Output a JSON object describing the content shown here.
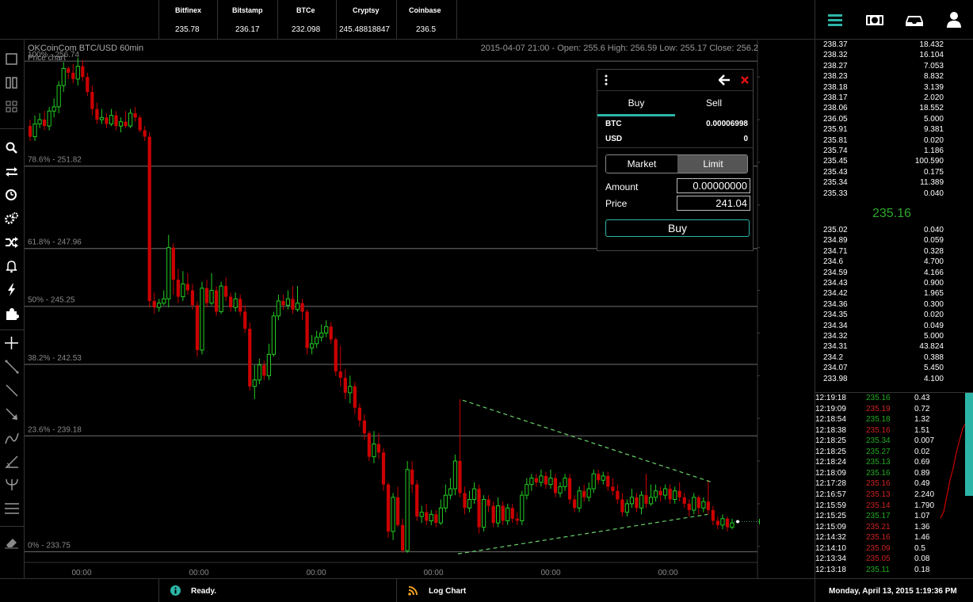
{
  "tickers": [
    {
      "name": "Bitfinex",
      "value": "235.78"
    },
    {
      "name": "Bitstamp",
      "value": "236.17"
    },
    {
      "name": "BTCe",
      "value": "232.098"
    },
    {
      "name": "Cryptsy",
      "value": "245.48818847"
    },
    {
      "name": "Coinbase",
      "value": "236.5"
    }
  ],
  "colors": {
    "up": "#22cc22",
    "down": "#cc0000",
    "accent": "#2cb5a7",
    "fib": "#555555",
    "trend": "#6bd36b"
  },
  "toolbar_icons": [
    "menu-icon",
    "money-icon",
    "inbox-icon",
    "user-icon"
  ],
  "left_tools": [
    "single-layout-icon",
    "split-layout-icon",
    "grid-layout-icon",
    "search-icon",
    "swap-icon",
    "clock-icon",
    "settings-icon",
    "shuffle-icon",
    "bell-icon",
    "lightning-icon",
    "puzzle-icon",
    "crosshair-icon",
    "line-tool-icon",
    "segment-tool-icon",
    "arrow-tool-icon",
    "curve-tool-icon",
    "angle-tool-icon",
    "pitchfork-tool-icon",
    "parallel-lines-icon",
    "eraser-icon"
  ],
  "chart": {
    "title": "OKCoinCom BTC/USD 60min",
    "subtitle": "Price chart",
    "ohlc": "2015-04-07 21:00 - Open: 255.6 High: 256.59 Low: 255.17 Close: 256.2"
  },
  "chart_data": {
    "type": "candlestick",
    "title": "OKCoinCom BTC/USD 60min",
    "ylim": [
      233.25,
      257.75
    ],
    "y_ticks": [
      234,
      236,
      238,
      240,
      242,
      244,
      246,
      248,
      250,
      252,
      254,
      256
    ],
    "x_ticks": [
      "00:00",
      "00:00",
      "00:00",
      "00:00",
      "00:00",
      "00:00"
    ],
    "fib_levels": [
      {
        "label": "100% - 256.74",
        "value": 256.74
      },
      {
        "label": "78.6% - 251.82",
        "value": 251.82
      },
      {
        "label": "61.8% - 247.96",
        "value": 247.96
      },
      {
        "label": "50% - 245.25",
        "value": 245.25
      },
      {
        "label": "38.2% - 242.53",
        "value": 242.53
      },
      {
        "label": "23.6% - 239.18",
        "value": 239.18
      },
      {
        "label": "0% - 233.75",
        "value": 233.75
      }
    ],
    "candles": [
      [
        253.7,
        253.2,
        254.0,
        253.0
      ],
      [
        253.2,
        253.8,
        254.2,
        253.0
      ],
      [
        253.8,
        254.0,
        254.3,
        253.6
      ],
      [
        254.0,
        253.7,
        254.4,
        253.5
      ],
      [
        253.7,
        254.4,
        254.6,
        253.5
      ],
      [
        254.4,
        254.6,
        255.0,
        254.1
      ],
      [
        254.6,
        255.6,
        255.8,
        254.3
      ],
      [
        255.6,
        256.4,
        256.7,
        255.3
      ],
      [
        256.4,
        256.2,
        256.5,
        255.9
      ],
      [
        256.2,
        255.9,
        256.6,
        255.7
      ],
      [
        255.9,
        256.5,
        256.9,
        255.6
      ],
      [
        256.5,
        256.0,
        256.8,
        255.8
      ],
      [
        256.0,
        255.3,
        256.2,
        255.1
      ],
      [
        255.3,
        254.5,
        255.6,
        254.2
      ],
      [
        254.5,
        254.0,
        254.8,
        253.8
      ],
      [
        254.0,
        254.1,
        254.5,
        253.8
      ],
      [
        254.1,
        253.8,
        254.3,
        253.6
      ],
      [
        253.8,
        254.2,
        254.5,
        253.7
      ],
      [
        254.2,
        253.7,
        254.4,
        253.5
      ],
      [
        253.7,
        253.9,
        254.1,
        253.4
      ],
      [
        253.9,
        253.7,
        254.4,
        253.6
      ],
      [
        253.7,
        254.3,
        254.5,
        253.6
      ],
      [
        254.3,
        254.1,
        254.6,
        253.9
      ],
      [
        254.1,
        253.5,
        254.2,
        253.4
      ],
      [
        253.5,
        253.2,
        253.7,
        253.0
      ],
      [
        253.2,
        245.5,
        253.4,
        245.2
      ],
      [
        245.5,
        245.2,
        245.9,
        244.9
      ],
      [
        245.2,
        245.4,
        245.6,
        245.0
      ],
      [
        245.4,
        245.6,
        246.0,
        245.3
      ],
      [
        245.6,
        248.0,
        248.6,
        245.2
      ],
      [
        248.0,
        246.5,
        248.2,
        245.8
      ],
      [
        246.5,
        245.7,
        247.0,
        245.4
      ],
      [
        245.7,
        246.3,
        246.9,
        245.5
      ],
      [
        246.3,
        246.0,
        246.8,
        245.8
      ],
      [
        246.0,
        245.3,
        246.3,
        245.1
      ],
      [
        245.3,
        243.2,
        245.5,
        242.9
      ],
      [
        243.2,
        246.1,
        246.4,
        243.0
      ],
      [
        246.1,
        245.4,
        246.5,
        245.2
      ],
      [
        245.4,
        246.0,
        246.8,
        245.3
      ],
      [
        246.0,
        245.0,
        246.2,
        244.8
      ],
      [
        245.0,
        246.2,
        246.4,
        244.9
      ],
      [
        246.2,
        245.7,
        246.6,
        245.5
      ],
      [
        245.7,
        245.2,
        245.9,
        245.0
      ],
      [
        245.2,
        245.6,
        245.9,
        245.0
      ],
      [
        245.6,
        245.0,
        245.8,
        244.8
      ],
      [
        245.0,
        244.2,
        245.3,
        244.0
      ],
      [
        244.2,
        241.5,
        244.5,
        241.3
      ],
      [
        241.5,
        241.8,
        242.5,
        240.9
      ],
      [
        241.8,
        242.5,
        242.8,
        241.6
      ],
      [
        242.5,
        242.0,
        242.7,
        241.8
      ],
      [
        242.0,
        243.0,
        243.5,
        241.8
      ],
      [
        243.0,
        244.8,
        245.0,
        242.9
      ],
      [
        244.8,
        245.5,
        245.8,
        244.6
      ],
      [
        245.5,
        245.3,
        245.8,
        245.1
      ],
      [
        245.3,
        245.6,
        246.0,
        245.1
      ],
      [
        245.6,
        245.1,
        246.2,
        244.9
      ],
      [
        245.1,
        245.4,
        246.2,
        245.0
      ],
      [
        245.4,
        245.0,
        245.6,
        244.6
      ],
      [
        245.0,
        243.3,
        245.1,
        243.0
      ],
      [
        243.3,
        243.5,
        243.9,
        243.0
      ],
      [
        243.5,
        243.8,
        244.1,
        243.3
      ],
      [
        243.8,
        244.0,
        244.4,
        243.6
      ],
      [
        244.0,
        244.3,
        244.6,
        243.8
      ],
      [
        244.3,
        243.7,
        244.5,
        243.5
      ],
      [
        243.7,
        242.2,
        243.8,
        242.0
      ],
      [
        242.2,
        241.9,
        243.4,
        241.5
      ],
      [
        241.9,
        241.2,
        242.3,
        240.9
      ],
      [
        241.2,
        241.5,
        242.0,
        240.7
      ],
      [
        241.5,
        240.5,
        241.7,
        240.2
      ],
      [
        240.5,
        239.9,
        240.7,
        239.6
      ],
      [
        239.9,
        239.3,
        240.2,
        239.0
      ],
      [
        239.3,
        238.2,
        239.4,
        238.0
      ],
      [
        238.2,
        238.8,
        239.4,
        237.9
      ],
      [
        238.8,
        238.4,
        239.3,
        238.1
      ],
      [
        238.4,
        236.9,
        238.6,
        236.6
      ],
      [
        236.9,
        234.7,
        237.0,
        234.4
      ],
      [
        234.7,
        236.3,
        236.5,
        234.3
      ],
      [
        236.3,
        235.0,
        236.8,
        234.9
      ],
      [
        235.0,
        233.8,
        235.3,
        233.7
      ],
      [
        233.8,
        237.6,
        238.0,
        233.7
      ],
      [
        237.6,
        236.9,
        238.0,
        236.5
      ],
      [
        236.9,
        235.4,
        237.1,
        235.2
      ],
      [
        235.4,
        235.6,
        235.9,
        235.1
      ],
      [
        235.6,
        235.2,
        236.0,
        235.0
      ],
      [
        235.2,
        235.5,
        235.7,
        235.0
      ],
      [
        235.5,
        235.1,
        235.7,
        234.9
      ],
      [
        235.1,
        235.8,
        236.2,
        235.0
      ],
      [
        235.8,
        236.4,
        236.9,
        235.6
      ],
      [
        236.4,
        236.7,
        237.2,
        236.2
      ],
      [
        236.7,
        238.0,
        238.3,
        236.4
      ],
      [
        238.0,
        236.5,
        240.9,
        236.3
      ],
      [
        236.5,
        235.8,
        236.8,
        235.5
      ],
      [
        235.8,
        236.2,
        236.6,
        235.6
      ],
      [
        236.2,
        236.7,
        237.0,
        236.0
      ],
      [
        236.7,
        234.9,
        236.9,
        234.6
      ],
      [
        234.9,
        236.2,
        236.4,
        234.7
      ],
      [
        236.2,
        235.9,
        236.4,
        235.6
      ],
      [
        235.9,
        235.1,
        236.1,
        234.9
      ],
      [
        235.1,
        235.9,
        236.3,
        234.9
      ],
      [
        235.9,
        235.2,
        236.1,
        235.0
      ],
      [
        235.2,
        235.8,
        236.0,
        235.0
      ],
      [
        235.8,
        235.3,
        236.0,
        235.1
      ],
      [
        235.3,
        235.2,
        235.6,
        235.0
      ],
      [
        235.2,
        236.4,
        236.6,
        235.0
      ],
      [
        236.4,
        236.9,
        237.2,
        236.2
      ],
      [
        236.9,
        237.2,
        237.4,
        236.6
      ],
      [
        237.2,
        237.0,
        237.4,
        236.8
      ],
      [
        237.0,
        237.3,
        237.6,
        236.8
      ],
      [
        237.3,
        236.9,
        237.5,
        236.7
      ],
      [
        236.9,
        237.2,
        237.6,
        236.7
      ],
      [
        237.2,
        236.5,
        237.4,
        236.3
      ],
      [
        236.5,
        236.8,
        237.0,
        236.3
      ],
      [
        236.8,
        237.2,
        237.4,
        236.6
      ],
      [
        237.2,
        236.2,
        237.4,
        236.0
      ],
      [
        236.2,
        235.8,
        236.4,
        235.6
      ],
      [
        235.8,
        236.6,
        236.8,
        235.6
      ],
      [
        236.6,
        236.3,
        236.9,
        236.1
      ],
      [
        236.3,
        236.7,
        237.0,
        236.1
      ],
      [
        236.7,
        237.4,
        237.6,
        236.5
      ],
      [
        237.4,
        237.1,
        237.6,
        236.9
      ],
      [
        237.1,
        237.3,
        237.5,
        236.9
      ],
      [
        237.3,
        236.8,
        237.5,
        236.6
      ],
      [
        236.8,
        236.6,
        237.2,
        236.4
      ],
      [
        236.6,
        236.2,
        236.9,
        236.0
      ],
      [
        236.2,
        235.6,
        236.5,
        235.4
      ],
      [
        235.6,
        236.0,
        236.2,
        235.4
      ],
      [
        236.0,
        236.3,
        236.7,
        235.8
      ],
      [
        236.3,
        235.8,
        236.5,
        235.6
      ],
      [
        235.8,
        236.4,
        236.6,
        235.5
      ],
      [
        236.4,
        236.0,
        237.4,
        235.8
      ],
      [
        236.0,
        236.3,
        236.9,
        235.9
      ],
      [
        236.3,
        236.6,
        236.9,
        236.1
      ],
      [
        236.6,
        236.4,
        236.8,
        236.1
      ],
      [
        236.4,
        236.7,
        236.9,
        236.2
      ],
      [
        236.7,
        236.2,
        236.9,
        236.0
      ],
      [
        236.2,
        236.6,
        236.8,
        236.0
      ],
      [
        236.6,
        236.3,
        237.0,
        236.1
      ],
      [
        236.3,
        236.0,
        236.5,
        235.8
      ],
      [
        236.0,
        235.7,
        236.2,
        235.4
      ],
      [
        235.7,
        236.3,
        236.5,
        235.5
      ],
      [
        236.3,
        235.8,
        236.4,
        235.5
      ],
      [
        235.8,
        236.1,
        236.3,
        235.6
      ],
      [
        236.1,
        235.7,
        237.1,
        235.5
      ],
      [
        235.7,
        235.2,
        235.9,
        235.0
      ],
      [
        235.2,
        235.0,
        235.4,
        234.8
      ],
      [
        235.0,
        235.3,
        235.5,
        234.8
      ],
      [
        235.3,
        234.9,
        235.4,
        234.7
      ],
      [
        234.9,
        235.1,
        235.3,
        234.8
      ]
    ],
    "last_price": 235.16
  },
  "order_panel": {
    "tabs": [
      "Buy",
      "Sell"
    ],
    "btc_label": "BTC",
    "btc_value": "0.00006998",
    "usd_label": "USD",
    "usd_value": "0",
    "market_label": "Market",
    "limit_label": "Limit",
    "amount_label": "Amount",
    "amount_value": "0.00000000",
    "price_label": "Price",
    "price_value": "241.04",
    "buy_button": "Buy"
  },
  "order_book": {
    "asks": [
      [
        "238.37",
        "18.432"
      ],
      [
        "238.32",
        "16.104"
      ],
      [
        "238.27",
        "7.053"
      ],
      [
        "238.23",
        "8.832"
      ],
      [
        "238.18",
        "3.139"
      ],
      [
        "238.17",
        "2.020"
      ],
      [
        "238.06",
        "18.552"
      ],
      [
        "236.05",
        "5.000"
      ],
      [
        "235.91",
        "9.381"
      ],
      [
        "235.81",
        "0.020"
      ],
      [
        "235.74",
        "1.186"
      ],
      [
        "235.45",
        "100.590"
      ],
      [
        "235.43",
        "0.175"
      ],
      [
        "235.34",
        "11.389"
      ],
      [
        "235.33",
        "0.040"
      ]
    ],
    "mid": "235.16",
    "bids": [
      [
        "235.02",
        "0.040"
      ],
      [
        "234.89",
        "0.059"
      ],
      [
        "234.71",
        "0.328"
      ],
      [
        "234.6",
        "4.700"
      ],
      [
        "234.59",
        "4.166"
      ],
      [
        "234.43",
        "0.900"
      ],
      [
        "234.42",
        "1.965"
      ],
      [
        "234.36",
        "0.300"
      ],
      [
        "234.35",
        "0.020"
      ],
      [
        "234.34",
        "0.049"
      ],
      [
        "234.32",
        "5.000"
      ],
      [
        "234.31",
        "43.824"
      ],
      [
        "234.2",
        "0.388"
      ],
      [
        "234.07",
        "5.450"
      ],
      [
        "233.98",
        "4.100"
      ]
    ]
  },
  "trades": [
    {
      "time": "12:19:18",
      "price": "235.16",
      "amount": "0.43",
      "side": "buy"
    },
    {
      "time": "12:19:09",
      "price": "235.19",
      "amount": "0.72",
      "side": "sell"
    },
    {
      "time": "12:18:54",
      "price": "235.18",
      "amount": "1.32",
      "side": "buy"
    },
    {
      "time": "12:18:38",
      "price": "235.16",
      "amount": "1.51",
      "side": "sell"
    },
    {
      "time": "12:18:25",
      "price": "235.34",
      "amount": "0.007",
      "side": "buy"
    },
    {
      "time": "12:18:25",
      "price": "235.27",
      "amount": "0.02",
      "side": "buy"
    },
    {
      "time": "12:18:24",
      "price": "235.13",
      "amount": "0.69",
      "side": "buy"
    },
    {
      "time": "12:18:09",
      "price": "235.16",
      "amount": "0.89",
      "side": "buy"
    },
    {
      "time": "12:17:28",
      "price": "235.16",
      "amount": "0.49",
      "side": "sell"
    },
    {
      "time": "12:16:57",
      "price": "235.13",
      "amount": "2.240",
      "side": "sell"
    },
    {
      "time": "12:15:59",
      "price": "235.14",
      "amount": "1.790",
      "side": "sell"
    },
    {
      "time": "12:15:25",
      "price": "235.17",
      "amount": "1.07",
      "side": "buy"
    },
    {
      "time": "12:15:09",
      "price": "235.21",
      "amount": "1.36",
      "side": "sell"
    },
    {
      "time": "12:14:32",
      "price": "235.16",
      "amount": "1.46",
      "side": "sell"
    },
    {
      "time": "12:14:10",
      "price": "235.09",
      "amount": "0.5",
      "side": "sell"
    },
    {
      "time": "12:13:34",
      "price": "235.05",
      "amount": "0.08",
      "side": "sell"
    },
    {
      "time": "12:13:18",
      "price": "235.11",
      "amount": "0.18",
      "side": "buy"
    }
  ],
  "status": {
    "ready": "Ready.",
    "log": "Log Chart",
    "datetime": "Monday, April 13, 2015 1:19:36 PM"
  }
}
